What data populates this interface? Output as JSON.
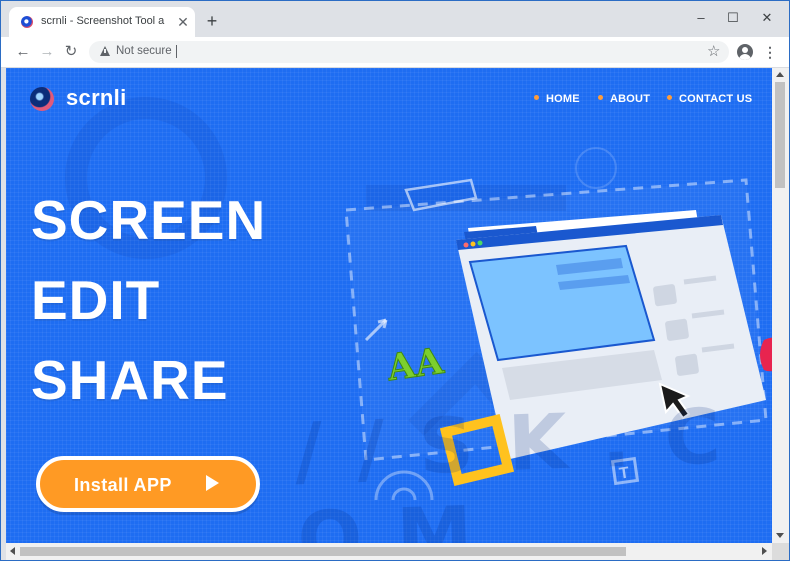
{
  "browser": {
    "tab_title": "scrnli - Screenshot Tool and Edito",
    "new_tab": "+",
    "security_label": "Not secure",
    "window_controls": {
      "minimize": "–",
      "maximize": "☐",
      "close": "✕"
    }
  },
  "site": {
    "logo_text": "scrnli",
    "nav": [
      "HOME",
      "ABOUT",
      "CONTACT US"
    ],
    "headline": [
      "SCREEN",
      "EDIT",
      "SHARE"
    ],
    "install_label": "Install APP"
  },
  "icons": {
    "back": "back-arrow-icon",
    "forward": "forward-arrow-icon",
    "reload": "reload-icon",
    "bookmark": "star-icon",
    "account": "account-icon",
    "menu": "kebab-menu-icon"
  },
  "colors": {
    "page_bg": "#1e6df2",
    "accent": "#ff9a24",
    "frame": "#2b6cc4",
    "window_card": "#e9eef6",
    "selection": "#7cc3ff",
    "square": "#ffc21e",
    "letters": "#7ccf2e"
  }
}
